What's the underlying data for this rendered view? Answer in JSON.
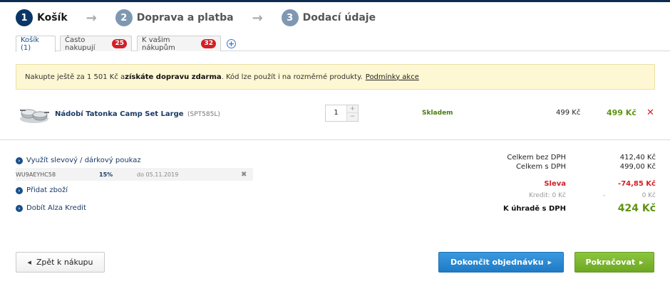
{
  "steps": [
    {
      "number": "1",
      "label": "Košík"
    },
    {
      "number": "2",
      "label": "Doprava a platba"
    },
    {
      "number": "3",
      "label": "Dodací údaje"
    }
  ],
  "step_arrow": "→",
  "tabs": [
    {
      "label": "Košík (1)",
      "badge": ""
    },
    {
      "label": "Často nakupují",
      "badge": "25"
    },
    {
      "label": "K vašim nákupům",
      "badge": "32"
    }
  ],
  "tab_add": "+",
  "notice": {
    "prefix": "Nakupte ještě za 1 501 Kč a ",
    "highlight": "získáte dopravu zdarma",
    "suffix": ". Kód lze použít i na rozměrné produkty.",
    "link": "Podmínky akce"
  },
  "product": {
    "name": "Nádobí Tatonka Camp Set Large",
    "code": "(SPT585L)",
    "quantity": "1",
    "qty_up": "+",
    "qty_down": "−",
    "stock": "Skladem",
    "unit_price": "499 Kč",
    "total_price": "499 Kč",
    "remove": "✕"
  },
  "actions": {
    "voucher_link": "Využít slevový / dárkový poukaz",
    "add_goods": "Přidat zboží",
    "top_up_credit": "Dobít Alza Kredit"
  },
  "voucher": {
    "code": "WU9AEYHC58",
    "percent": "15%",
    "valid_until": "do 05.11.2019",
    "remove": "✖"
  },
  "summary": {
    "without_vat_label": "Celkem bez DPH",
    "without_vat_value": "412,40 Kč",
    "with_vat_label": "Celkem s DPH",
    "with_vat_value": "499,00 Kč",
    "discount_label": "Sleva",
    "discount_value": "-74,85 Kč",
    "credit_label": "Kredit: 0 Kč",
    "credit_dash": "-",
    "credit_value": "0 Kč",
    "total_label": "K úhradě s DPH",
    "total_value": "424 Kč"
  },
  "buttons": {
    "back": "Zpět k nákupu",
    "finish": "Dokončit objednávku",
    "continue": "Pokračovat"
  },
  "colors": {
    "accent_blue": "#0b3566",
    "price_green": "#5f9313",
    "discount_red": "#d31f26"
  }
}
